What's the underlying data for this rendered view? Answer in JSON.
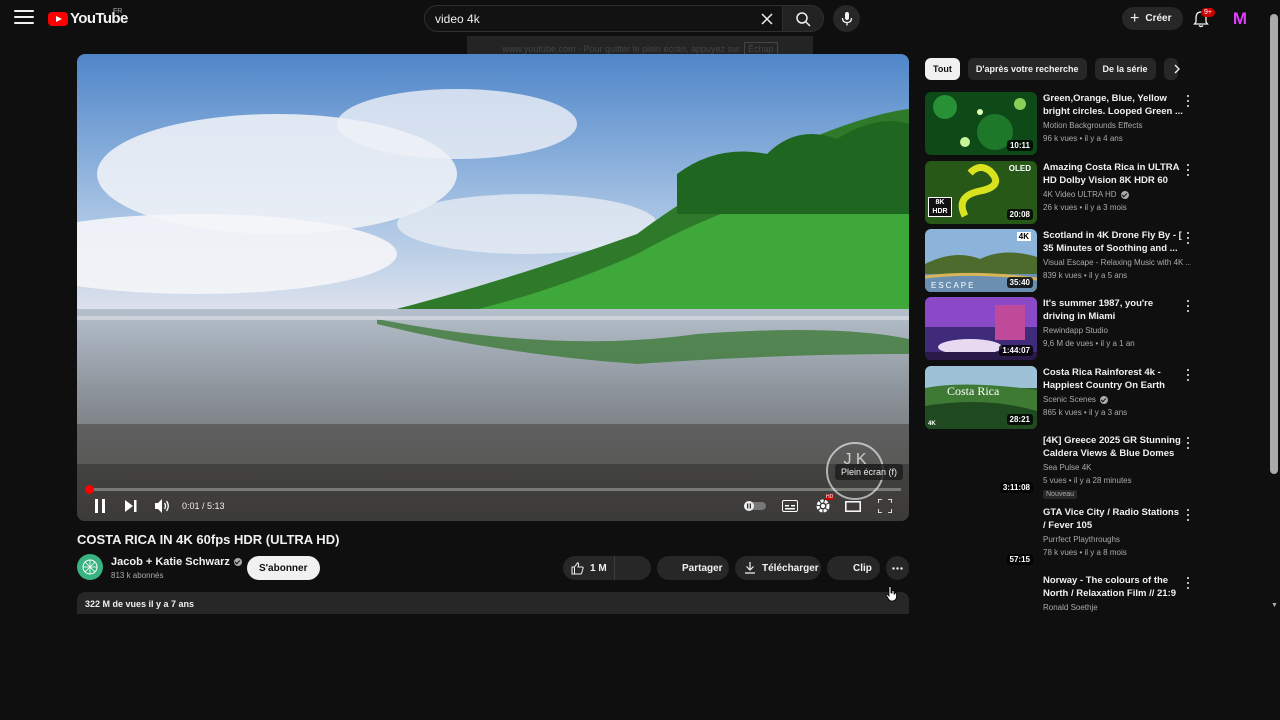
{
  "header": {
    "logo_text": "YouTube",
    "region": "FR",
    "search_value": "video 4k",
    "create_label": "Créer",
    "notif_badge": "9+",
    "avatar_letter": "M"
  },
  "fullscreen_hint": {
    "text": "www.youtube.com - Pour quitter le plein écran, appuyez sur",
    "key": "Échap"
  },
  "player": {
    "current_time": "0:01",
    "duration": "5:13",
    "progress_fraction": 0.003,
    "tooltip": "Plein écran (f)",
    "quality_badge": "HD",
    "watermark": "J K"
  },
  "video": {
    "title": "COSTA RICA IN 4K 60fps HDR (ULTRA HD)",
    "channel": "Jacob + Katie Schwarz",
    "subscribers": "813 k abonnés",
    "subscribe_label": "S'abonner",
    "likes": "1 M",
    "share_label": "Partager",
    "download_label": "Télécharger",
    "clip_label": "Clip",
    "views_date": "322 M de vues  il y a 7 ans"
  },
  "chips": [
    "Tout",
    "D'après votre recherche",
    "De la série"
  ],
  "recommendations": [
    {
      "title": "Green,Orange, Blue, Yellow bright circles. Looped Green ...",
      "channel": "Motion Backgrounds Effects",
      "meta": "96 k vues • il y a 4 ans",
      "duration": "10:11",
      "verified": false,
      "theme": "green"
    },
    {
      "title": "Amazing Costa Rica in ULTRA HD Dolby Vision 8K HDR 60 FP...",
      "channel": "4K Video ULTRA HD",
      "meta": "26 k vues • il y a 3 mois",
      "duration": "20:08",
      "verified": true,
      "theme": "snake",
      "thumb_text": "OLED",
      "thumb_badge": "8K HDR"
    },
    {
      "title": "Scotland in 4K Drone Fly By - [ 35 Minutes of Soothing and ...",
      "channel": "Visual Escape - Relaxing Music with 4K ...",
      "meta": "839 k vues • il y a 5 ans",
      "duration": "35:40",
      "verified": false,
      "theme": "scotland",
      "thumb_text": "ESCAPE",
      "thumb_badge": "4K"
    },
    {
      "title": "It's summer 1987, you're driving in Miami",
      "channel": "Rewindapp Studio",
      "meta": "9,6 M de vues • il y a 1 an",
      "duration": "1:44:07",
      "verified": false,
      "theme": "miami"
    },
    {
      "title": "Costa Rica Rainforest 4k - Happiest Country On Earth Wit...",
      "channel": "Scenic Scenes",
      "meta": "865 k vues • il y a 3 ans",
      "duration": "28:21",
      "verified": true,
      "theme": "rainforest",
      "thumb_text": "Costa Rica",
      "thumb_badge": "4K"
    },
    {
      "title": "[4K] Greece 2025 GR Stunning Caldera Views & Blue Domes ...",
      "channel": "Sea Pulse 4K",
      "meta": "5 vues • il y a 28 minutes",
      "duration": "3:11:08",
      "verified": false,
      "theme": "blank",
      "badge": "Nouveau"
    },
    {
      "title": "GTA Vice City / Radio Stations / Fever 105",
      "channel": "Purrfect Playthroughs",
      "meta": "78 k vues • il y a 8 mois",
      "duration": "57:15",
      "verified": false,
      "theme": "blank"
    },
    {
      "title": "Norway - The colours of the North / Relaxation Film // 21:9 ...",
      "channel": "Ronald Soethje",
      "meta": "",
      "duration": "",
      "verified": false,
      "theme": "blank"
    }
  ],
  "colors": {
    "accent": "#ff0000",
    "bg": "#0f0f0f",
    "surface": "#272727"
  }
}
